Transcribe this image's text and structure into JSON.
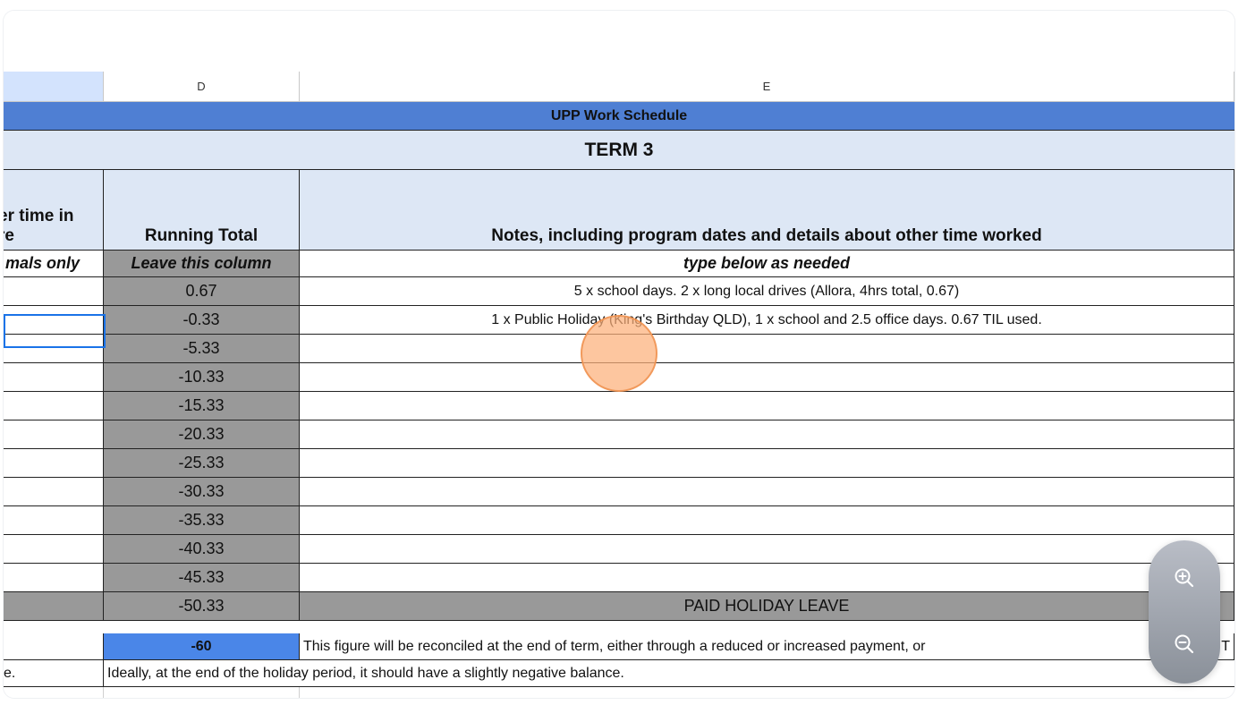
{
  "column_headers": {
    "c": "",
    "d": "D",
    "e": "E"
  },
  "sheet": {
    "banner_title": "UPP Work Schedule",
    "term_title": "TERM 3",
    "header_c_line1": "er time in",
    "header_c_line2": "re",
    "header_d": "Running Total",
    "header_e": "Notes, including program dates and details about other time worked",
    "sub_c": "mals only",
    "sub_d": "Leave this column",
    "sub_e": "type below as needed",
    "rows": [
      {
        "total": "0.67",
        "note": "5 x school days. 2 x long local drives (Allora, 4hrs total, 0.67)"
      },
      {
        "total": "-0.33",
        "note": "1 x Public Holiday (King's Birthday QLD), 1 x school and 2.5 office days. 0.67 TIL used."
      },
      {
        "total": "-5.33",
        "note": ""
      },
      {
        "total": "-10.33",
        "note": ""
      },
      {
        "total": "-15.33",
        "note": ""
      },
      {
        "total": "-20.33",
        "note": ""
      },
      {
        "total": "-25.33",
        "note": ""
      },
      {
        "total": "-30.33",
        "note": ""
      },
      {
        "total": "-35.33",
        "note": ""
      },
      {
        "total": "-40.33",
        "note": ""
      },
      {
        "total": "-45.33",
        "note": ""
      },
      {
        "total": "-50.33",
        "note": "PAID HOLIDAY LEAVE"
      }
    ],
    "final_total": "-60",
    "final_note": "This figure will be reconciled at the end of term, either through a reduced or increased payment, or",
    "final_note_tail": "T",
    "last_c": "e.",
    "last_note": "Ideally, at the end of the holiday period, it should have a slightly negative balance."
  },
  "zoom": {
    "in_icon": "zoom-in-icon",
    "out_icon": "zoom-out-icon"
  },
  "colors": {
    "banner": "#4f7fd3",
    "light_header": "#dde7f5",
    "total_gray": "#999999",
    "final_blue": "#4a86e8",
    "selection": "#1a73e8"
  }
}
